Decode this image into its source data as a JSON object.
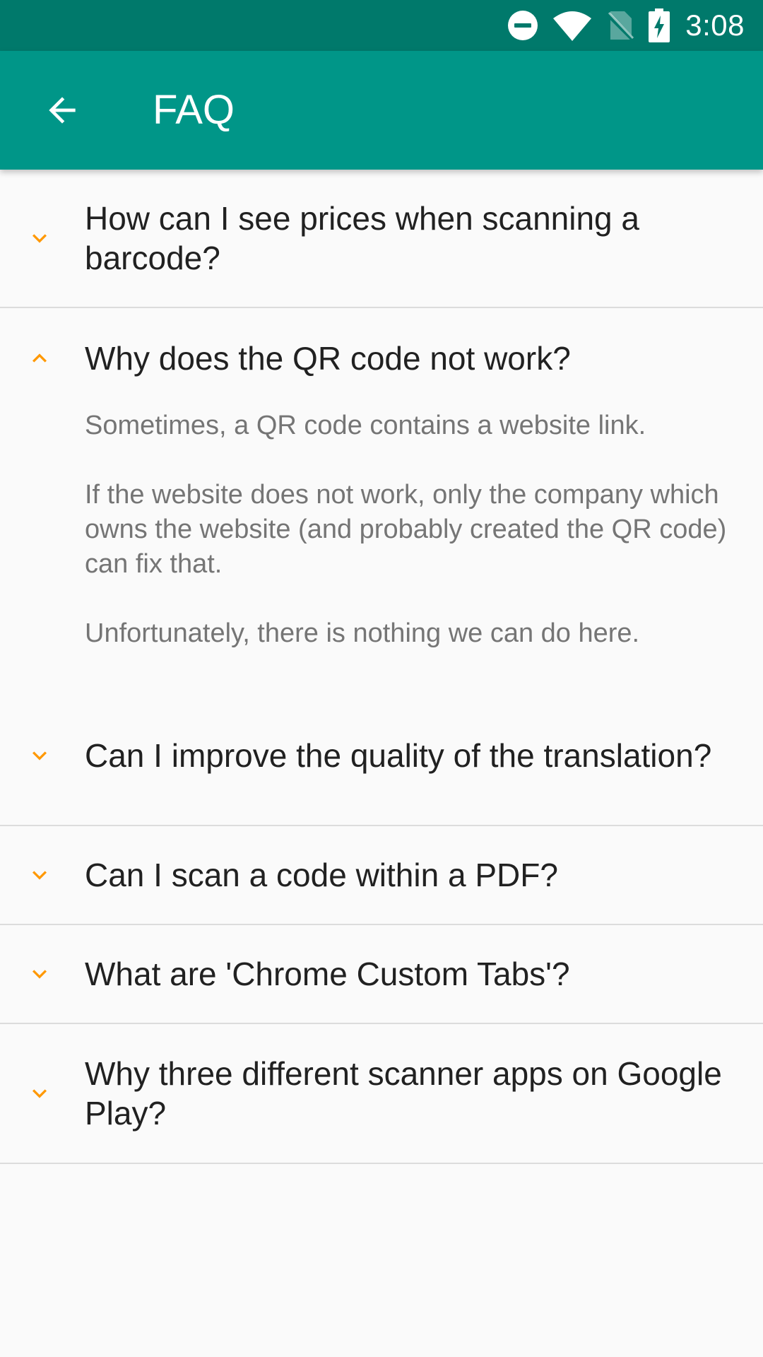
{
  "status_bar": {
    "time": "3:08",
    "icons": [
      "do-not-disturb-icon",
      "wifi-icon",
      "no-sim-icon",
      "battery-charging-icon"
    ],
    "background": "#00796b"
  },
  "app_bar": {
    "title": "FAQ",
    "back_icon": "arrow-back-icon",
    "background": "#009688"
  },
  "accent_color": "#ff9800",
  "faq": {
    "items": [
      {
        "question": "How can I see prices when scanning a barcode?",
        "expanded": false
      },
      {
        "question": "Why does the QR code not work?",
        "expanded": true,
        "answer": [
          "Sometimes, a QR code contains a website link.",
          "If the website does not work, only the company which owns the website (and probably created the QR code) can fix that.",
          "Unfortunately, there is nothing we can do here."
        ]
      },
      {
        "question": "Can I improve the quality of the translation?",
        "expanded": false
      },
      {
        "question": "Can I scan a code within a PDF?",
        "expanded": false
      },
      {
        "question": "What are 'Chrome Custom Tabs'?",
        "expanded": false
      },
      {
        "question": "Why three different scanner apps on Google Play?",
        "expanded": false
      }
    ]
  }
}
